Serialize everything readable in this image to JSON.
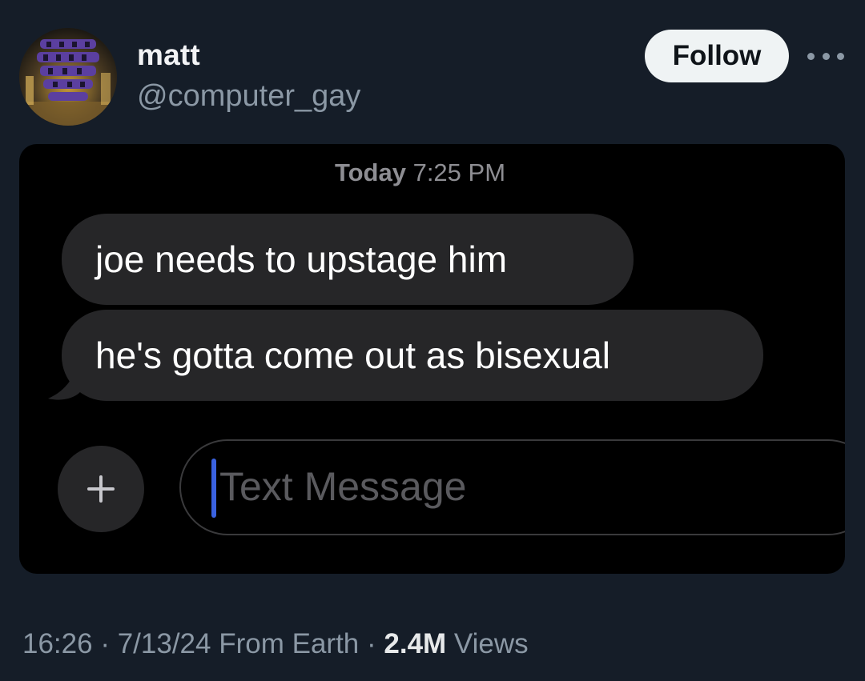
{
  "author": {
    "display_name": "matt",
    "handle": "@computer_gay",
    "avatar_icon": "vessel-structure-photo"
  },
  "actions": {
    "follow_label": "Follow",
    "more_icon": "more-horizontal-icon"
  },
  "screenshot": {
    "timestamp_day": "Today",
    "timestamp_time": "7:25 PM",
    "messages": [
      {
        "text": "joe needs to upstage him"
      },
      {
        "text": "he's gotta come out as bisexual"
      }
    ],
    "compose": {
      "plus_icon": "plus-icon",
      "placeholder": "Text Message"
    }
  },
  "meta": {
    "time": "16:26",
    "date": "7/13/24",
    "source": "From Earth",
    "separator": " · ",
    "views_count": "2.4M",
    "views_label": "Views"
  },
  "colors": {
    "background": "#151d28",
    "bubble": "#262628",
    "cursor": "#3a62e0",
    "follow_button": "#eff3f4"
  }
}
